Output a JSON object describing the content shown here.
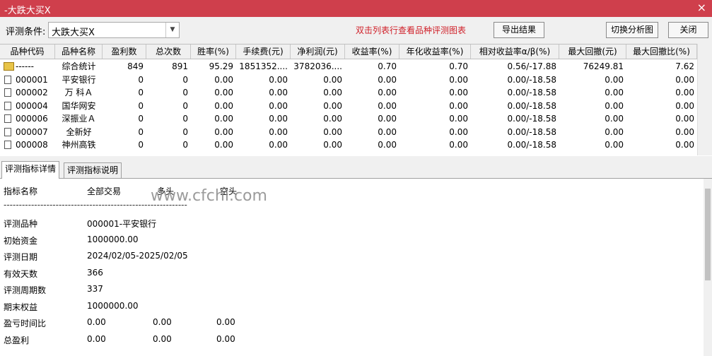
{
  "window": {
    "title": "-大跌大买X",
    "close_glyph": "×"
  },
  "toolbar": {
    "criteria_label": "评测条件:",
    "criteria_value": "大跌大买X",
    "hint": "双击列表行查看品种评测图表",
    "export_label": "导出结果",
    "switch_label": "切换分析图",
    "close_label": "关闭"
  },
  "table": {
    "headers": [
      "品种代码",
      "品种名称",
      "盈利数",
      "总次数",
      "胜率(%)",
      "手续费(元)",
      "净利润(元)",
      "收益率(%)",
      "年化收益率(%)",
      "相对收益率α/β(%)",
      "最大回撤(元)",
      "最大回撤比(%)"
    ],
    "rows": [
      {
        "code": "------",
        "name": "综合统计",
        "profit": "849",
        "total": "891",
        "win": "95.29",
        "fee": "1851352....",
        "net": "3782036....",
        "ret": "0.70",
        "annual": "0.70",
        "alpha": "0.56/-17.88",
        "dd": "76249.81",
        "ddr": "7.62",
        "icon": "folder"
      },
      {
        "code": "000001",
        "name": "平安银行",
        "profit": "0",
        "total": "0",
        "win": "0.00",
        "fee": "0.00",
        "net": "0.00",
        "ret": "0.00",
        "annual": "0.00",
        "alpha": "0.00/-18.58",
        "dd": "0.00",
        "ddr": "0.00",
        "icon": "doc"
      },
      {
        "code": "000002",
        "name": "万 科Ａ",
        "profit": "0",
        "total": "0",
        "win": "0.00",
        "fee": "0.00",
        "net": "0.00",
        "ret": "0.00",
        "annual": "0.00",
        "alpha": "0.00/-18.58",
        "dd": "0.00",
        "ddr": "0.00",
        "icon": "doc"
      },
      {
        "code": "000004",
        "name": "国华网安",
        "profit": "0",
        "total": "0",
        "win": "0.00",
        "fee": "0.00",
        "net": "0.00",
        "ret": "0.00",
        "annual": "0.00",
        "alpha": "0.00/-18.58",
        "dd": "0.00",
        "ddr": "0.00",
        "icon": "doc"
      },
      {
        "code": "000006",
        "name": "深振业Ａ",
        "profit": "0",
        "total": "0",
        "win": "0.00",
        "fee": "0.00",
        "net": "0.00",
        "ret": "0.00",
        "annual": "0.00",
        "alpha": "0.00/-18.58",
        "dd": "0.00",
        "ddr": "0.00",
        "icon": "doc"
      },
      {
        "code": "000007",
        "name": "全新好",
        "profit": "0",
        "total": "0",
        "win": "0.00",
        "fee": "0.00",
        "net": "0.00",
        "ret": "0.00",
        "annual": "0.00",
        "alpha": "0.00/-18.58",
        "dd": "0.00",
        "ddr": "0.00",
        "icon": "doc"
      },
      {
        "code": "000008",
        "name": "神州高铁",
        "profit": "0",
        "total": "0",
        "win": "0.00",
        "fee": "0.00",
        "net": "0.00",
        "ret": "0.00",
        "annual": "0.00",
        "alpha": "0.00/-18.58",
        "dd": "0.00",
        "ddr": "0.00",
        "icon": "doc"
      }
    ]
  },
  "tabs": [
    "评测指标详情",
    "评测指标说明"
  ],
  "detail": {
    "header": {
      "name": "指标名称",
      "all": "全部交易",
      "long": "多头",
      "short": "空头"
    },
    "separator": "------------------------------------------------------------",
    "watermark": "www.cfchi.com",
    "items": [
      {
        "label": "评测品种",
        "v1": "000001-平安银行",
        "v2": "",
        "v3": ""
      },
      {
        "label": "初始资金",
        "v1": "1000000.00",
        "v2": "",
        "v3": ""
      },
      {
        "label": "评测日期",
        "v1": "2024/02/05-2025/02/05",
        "v2": "",
        "v3": ""
      },
      {
        "label": "有效天数",
        "v1": "366",
        "v2": "",
        "v3": ""
      },
      {
        "label": "评测周期数",
        "v1": "337",
        "v2": "",
        "v3": ""
      },
      {
        "label": "期末权益",
        "v1": "1000000.00",
        "v2": "",
        "v3": ""
      },
      {
        "label": "盈亏时间比",
        "v1": "0.00",
        "v2": "0.00",
        "v3": "0.00"
      },
      {
        "label": "总盈利",
        "v1": "0.00",
        "v2": "0.00",
        "v3": "0.00"
      }
    ]
  },
  "colors": {
    "titlebar": "#cf3f4c",
    "hint": "#d0212a"
  }
}
